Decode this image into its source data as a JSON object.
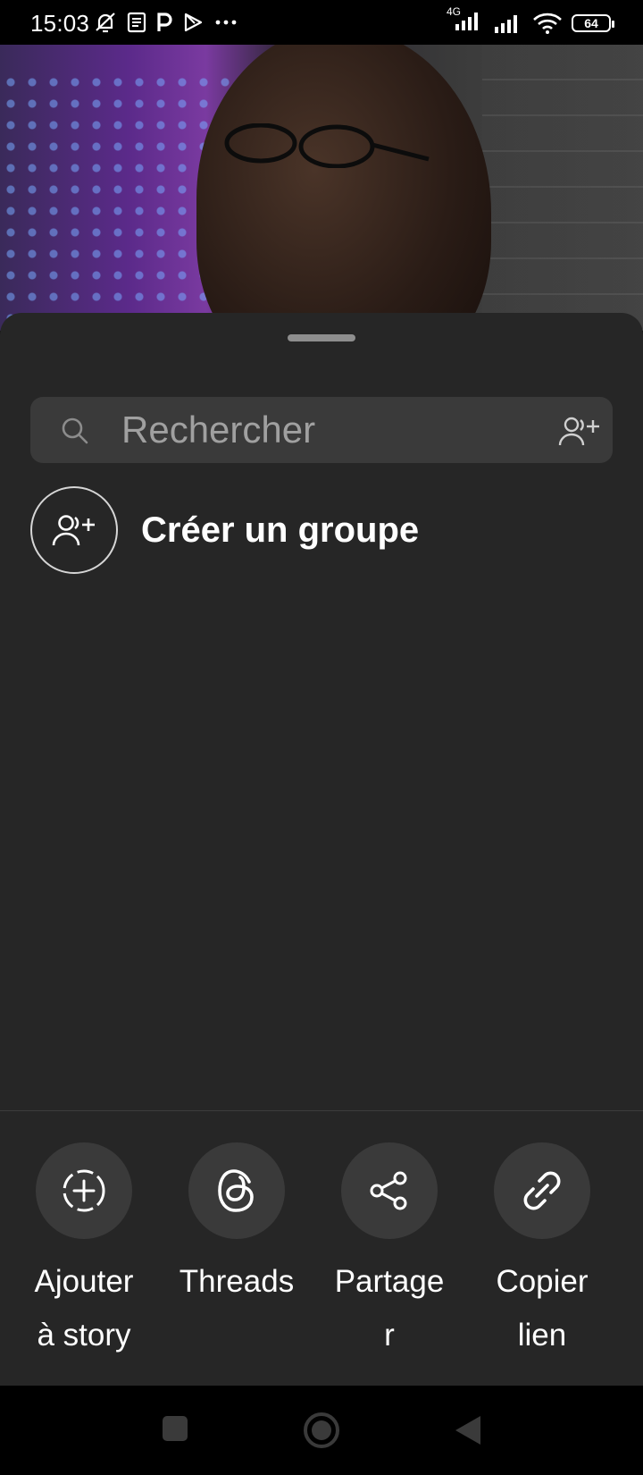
{
  "status_bar": {
    "time": "15:03",
    "network": "4G",
    "battery": "64"
  },
  "search": {
    "placeholder": "Rechercher"
  },
  "create_group": {
    "label": "Créer un groupe"
  },
  "actions": [
    {
      "label_line1": "Ajouter",
      "label_line2": "à story"
    },
    {
      "label_line1": "Threads",
      "label_line2": ""
    },
    {
      "label_line1": "Partage",
      "label_line2": "r"
    },
    {
      "label_line1": "Copier",
      "label_line2": "lien"
    }
  ],
  "colors": {
    "sheet_bg": "#262626",
    "search_bg": "#3a3a3a",
    "action_bg": "#3a3a3a",
    "placeholder": "#a0a0a0"
  },
  "icons": {
    "status_left": [
      "mute-bell-icon",
      "news-icon",
      "p-app-icon",
      "play-store-icon",
      "more-dots-icon"
    ],
    "status_right": [
      "signal-icon",
      "signal-icon",
      "wifi-icon",
      "battery-icon"
    ],
    "search": "search-icon",
    "search_right": "add-people-icon",
    "create_group": "add-group-icon",
    "actions": [
      "add-story-icon",
      "threads-icon",
      "share-icon",
      "link-icon"
    ],
    "nav": [
      "recents-square-icon",
      "home-circle-icon",
      "back-triangle-icon"
    ]
  }
}
